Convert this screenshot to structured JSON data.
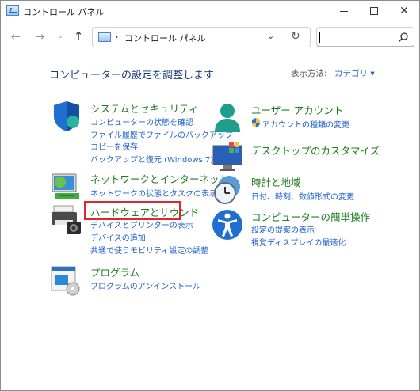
{
  "window": {
    "title": "コントロール パネル"
  },
  "address": {
    "path": "コントロール パネル",
    "separator": "›"
  },
  "search": {
    "value": "",
    "placeholder": ""
  },
  "heading": "コンピューターの設定を調整します",
  "view_by": {
    "label": "表示方法:",
    "value": "カテゴリ ▾"
  },
  "categories": [
    {
      "title": "システムとセキュリティ",
      "links": [
        "コンピューターの状態を確認",
        "ファイル履歴でファイルのバックアップ",
        "コピーを保存",
        "バックアップと復元 (Windows 7)"
      ]
    },
    {
      "title": "ネットワークとインターネット",
      "links": [
        "ネットワークの状態とタスクの表示"
      ]
    },
    {
      "title": "ハードウェアとサウンド",
      "links": [
        "デバイスとプリンターの表示",
        "デバイスの追加",
        "共通で使うモビリティ設定の調整"
      ]
    },
    {
      "title": "プログラム",
      "links": [
        "プログラムのアンインストール"
      ]
    },
    {
      "title": "ユーザー アカウント",
      "links": [
        "アカウントの種類の変更"
      ]
    },
    {
      "title": "デスクトップのカスタマイズ",
      "links": []
    },
    {
      "title": "時計と地域",
      "links": [
        "日付、時刻、数値形式の変更"
      ]
    },
    {
      "title": "コンピューターの簡単操作",
      "links": [
        "設定の提案の表示",
        "視覚ディスプレイの最適化"
      ]
    }
  ],
  "colors": {
    "heading": "#1a3a78",
    "category_title": "#1e7d1e",
    "link": "#1c5fd0",
    "highlight": "#e0262c"
  }
}
